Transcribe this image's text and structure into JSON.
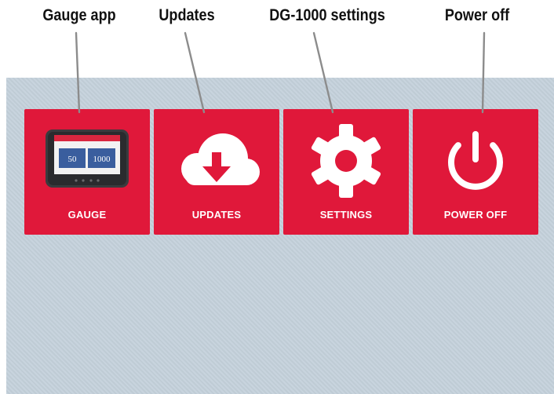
{
  "callouts": {
    "gauge": "Gauge app",
    "updates": "Updates",
    "settings": "DG-1000 settings",
    "power": "Power off"
  },
  "tiles": {
    "gauge": {
      "label": "GAUGE",
      "icon": "gauge-device-icon",
      "display_left": "50",
      "display_right": "1000"
    },
    "updates": {
      "label": "UPDATES",
      "icon": "cloud-download-icon"
    },
    "settings": {
      "label": "SETTINGS",
      "icon": "gear-icon"
    },
    "power": {
      "label": "POWER OFF",
      "icon": "power-icon"
    }
  },
  "colors": {
    "tile_background": "#e0183a",
    "screen_background": "#c5d2dc",
    "tile_text": "#ffffff",
    "leader_line": "#8c8c8c"
  }
}
